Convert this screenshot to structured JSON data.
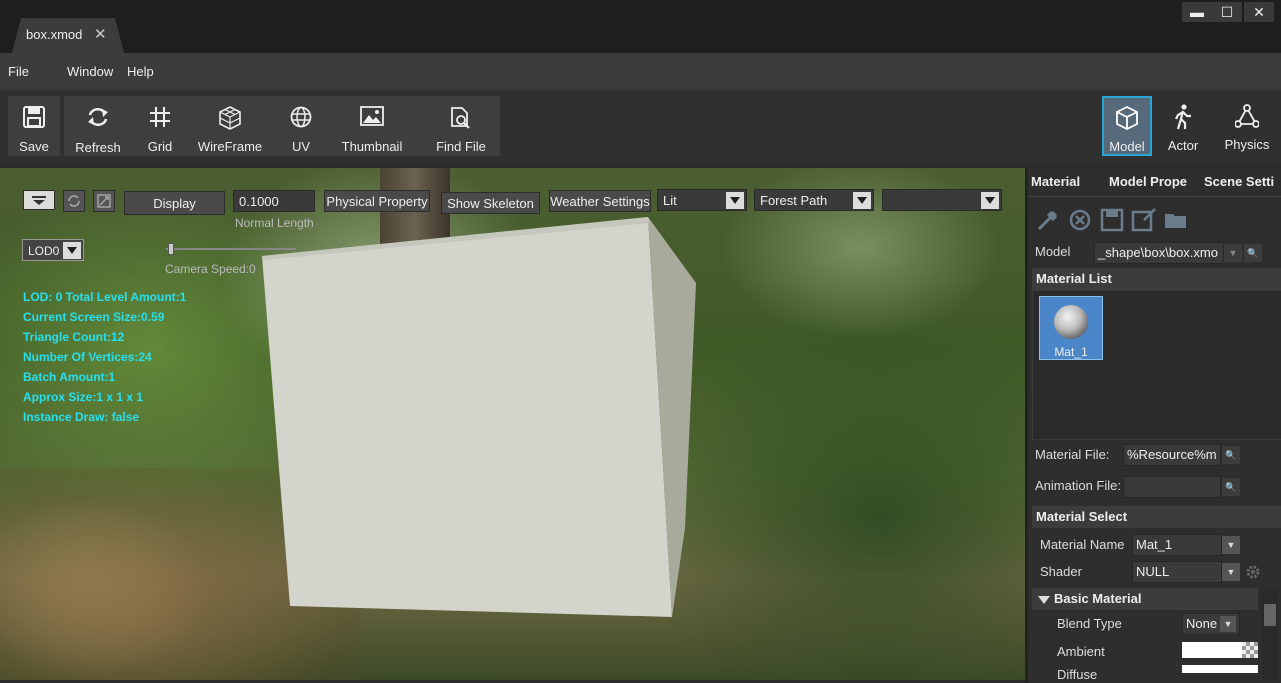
{
  "tab": {
    "title": "box.xmod",
    "close": "✕"
  },
  "window": {
    "minimize": "▬",
    "maximize": "☐",
    "close": "✕"
  },
  "menu": [
    "File",
    "Window",
    "Help"
  ],
  "toolbar": {
    "save": "Save",
    "refresh": "Refresh",
    "grid": "Grid",
    "wireframe": "WireFrame",
    "uv": "UV",
    "thumbnail": "Thumbnail",
    "find_file": "Find File",
    "model": "Model",
    "actor": "Actor",
    "physics": "Physics"
  },
  "viewport": {
    "display_button": "Display",
    "normal_length_value": "0.1000",
    "normal_length_label": "Normal Length",
    "physical_property_button": "Physical Property",
    "show_skeleton_button": "Show Skeleton",
    "weather_settings_button": "Weather Settings",
    "lighting_mode": "Lit",
    "environment": "Forest Path",
    "extra_select": "",
    "lod": "LOD0",
    "camera_speed_label": "Camera Speed:0",
    "stats": [
      "LOD: 0 Total Level Amount:1",
      "Current Screen Size:0.59",
      "Triangle Count:12",
      "Number Of Vertices:24",
      "Batch Amount:1",
      "Approx Size:1 x 1 x 1",
      "Instance Draw: false"
    ]
  },
  "panel": {
    "tabs": [
      "Material",
      "Model Prope",
      "Scene Setti"
    ],
    "model_label": "Model",
    "model_value": "_shape\\box\\box.xmo",
    "material_list_label": "Material List",
    "material_thumb": "Mat_1",
    "material_file_label": "Material File:",
    "material_file_value": "%Resource%m",
    "animation_file_label": "Animation File:",
    "animation_file_value": "",
    "material_select_label": "Material Select",
    "material_name_label": "Material Name",
    "material_name_value": "Mat_1",
    "shader_label": "Shader",
    "shader_value": "NULL",
    "basic_material_label": "Basic Material",
    "blend_type_label": "Blend Type",
    "blend_type_value": "None",
    "ambient_label": "Ambient",
    "diffuse_label": "Diffuse"
  },
  "colors": {
    "accent": "#2aa6d6",
    "stat_text": "#26e0f0",
    "panel_bg": "#2e2e2e"
  }
}
